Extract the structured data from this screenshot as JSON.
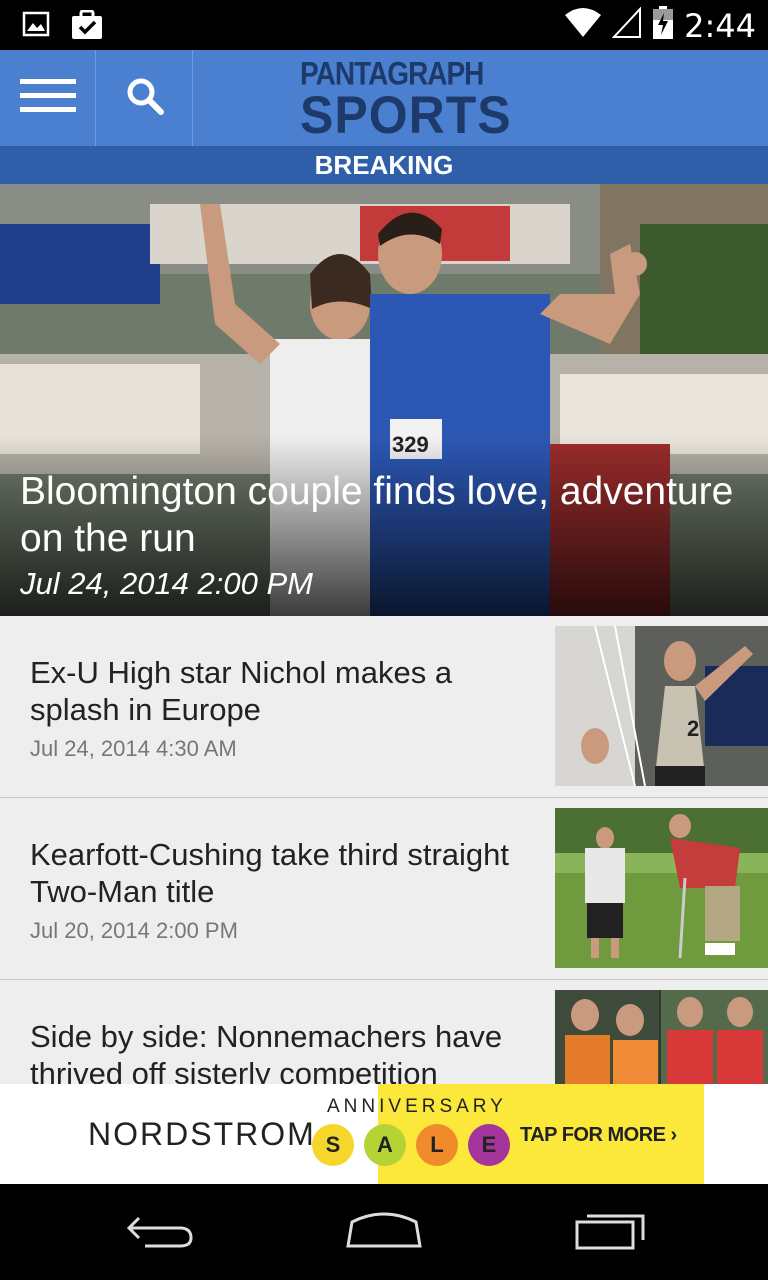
{
  "status_bar": {
    "time": "2:44",
    "icons": [
      "image-notification-icon",
      "clipboard-check-icon",
      "wifi-icon",
      "signal-icon",
      "battery-icon"
    ]
  },
  "app_bar": {
    "logo_top": "PANTAGRAPH",
    "logo_bottom": "SPORTS",
    "menu_icon": "hamburger-menu-icon",
    "search_icon": "search-icon"
  },
  "breaking_label": "BREAKING",
  "hero": {
    "title": "Bloomington couple finds love, adventure on the run",
    "date": "Jul 24, 2014 2:00 PM",
    "bib_number": "329"
  },
  "articles": [
    {
      "title": "Ex-U High star Nichol makes a splash in Europe",
      "date": "Jul 24, 2014 4:30 AM",
      "jersey_number": "2"
    },
    {
      "title": "Kearfott-Cushing take third straight Two-Man title",
      "date": "Jul 20, 2014 2:00 PM"
    },
    {
      "title": "Side by side: Nonnemachers have thrived off sisterly competition",
      "date": ""
    }
  ],
  "ad": {
    "brand": "NORDSTROM",
    "anniversary": "ANNIVERSARY",
    "sale_letters": [
      "S",
      "A",
      "L",
      "E"
    ],
    "sale_colors": [
      "#f5d62a",
      "#b5d334",
      "#f08a2a",
      "#a3359c"
    ],
    "cta": "TAP FOR MORE ›"
  },
  "nav_bar": {
    "icons": [
      "back-icon",
      "home-icon",
      "recent-apps-icon"
    ]
  },
  "colors": {
    "app_bar": "#4a80cf",
    "breaking_bar": "#2f5fa8",
    "logo_text": "#1d3a6b",
    "list_bg": "#eeeeee",
    "ad_yellow": "#fce83a"
  }
}
